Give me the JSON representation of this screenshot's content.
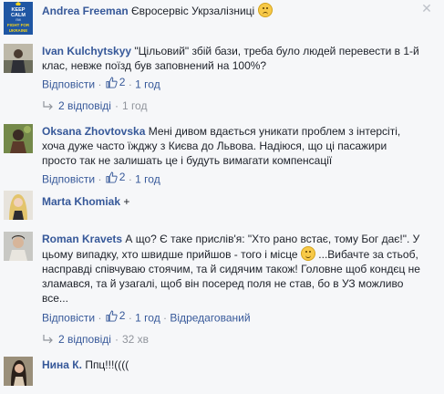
{
  "comments": [
    {
      "name": "Andrea Freeman",
      "text": "Євросервіс Укрзалізниці",
      "avatar_lines": [
        "KEEP",
        "CALM",
        "I'M",
        "FIGHT FOR",
        "UKRAINE"
      ]
    },
    {
      "name": "Ivan Kulchytskyy",
      "text_line1": "\"Цільовий\" збій бази, треба було людей перевести в 1-й",
      "text_line2": "клас, невже поїзд був заповнений на 100%?",
      "reply_label": "Відповісти",
      "likes": "2",
      "time": "1 год"
    },
    {
      "replies_label": "2 відповіді",
      "time": "1 год"
    },
    {
      "name": "Oksana Zhovtovska",
      "text_line1": "Мені дивом вдається уникати проблем з інтерсіті,",
      "text_line2": "хоча дуже часто їжджу з Києва до Львова. Надіюся, що ці пасажири",
      "text_line3": "просто так не залишать це і будуть вимагати компенсації",
      "reply_label": "Відповісти",
      "likes": "2",
      "time": "1 год"
    },
    {
      "name": "Marta Khomiak",
      "text": "+"
    },
    {
      "name": "Roman Kravets",
      "text_line1": "А що? Є таке прислів'я: \"Хто рано встає, тому Бог дає!\". У",
      "text_line2": "цьому випадку, хто швидше прийшов - того і місце",
      "text_line2b": "...Вибачте за стьоб,",
      "text_line3": "насправді співчуваю стоячим, та й сидячим також! Головне щоб кондєц не",
      "text_line4": "зламався, та й узагалі, щоб він посеред поля не став, бо в УЗ можливо",
      "text_line5": "все...",
      "reply_label": "Відповісти",
      "likes": "2",
      "time": "1 год",
      "edited": "Відредагований"
    },
    {
      "replies_label": "2 відповіді",
      "time": "32 хв"
    },
    {
      "name": "Нина К.",
      "text": "Ппц!!!(((("
    }
  ],
  "sep": "·",
  "close_glyph": "✕",
  "colors": {
    "link": "#365899",
    "muted": "#90949c",
    "bg": "#f6f7f9"
  }
}
